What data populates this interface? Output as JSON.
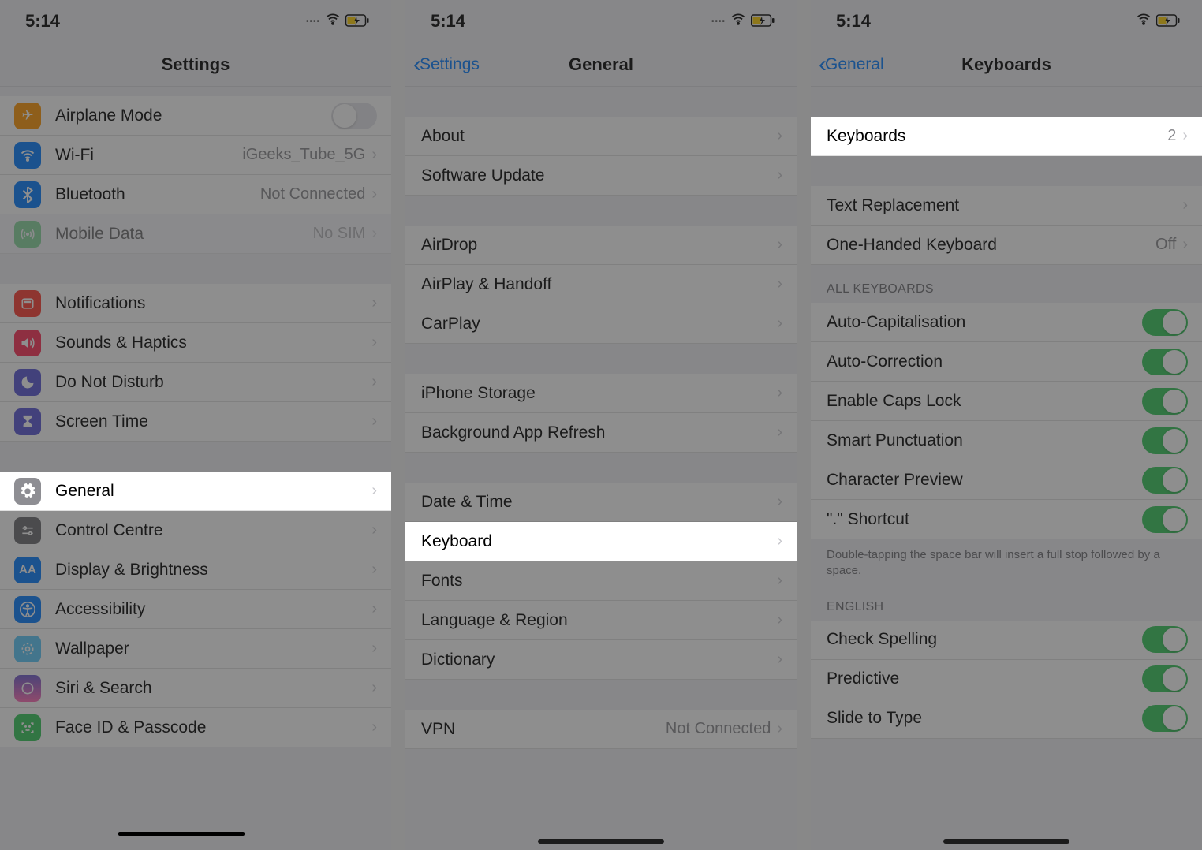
{
  "status": {
    "time": "5:14"
  },
  "phone1": {
    "title": "Settings",
    "rows": {
      "airplane": "Airplane Mode",
      "wifi": "Wi-Fi",
      "wifi_detail": "iGeeks_Tube_5G",
      "bluetooth": "Bluetooth",
      "bluetooth_detail": "Not Connected",
      "mobile": "Mobile Data",
      "mobile_detail": "No SIM",
      "notifications": "Notifications",
      "sounds": "Sounds & Haptics",
      "dnd": "Do Not Disturb",
      "screentime": "Screen Time",
      "general": "General",
      "control": "Control Centre",
      "display": "Display & Brightness",
      "accessibility": "Accessibility",
      "wallpaper": "Wallpaper",
      "siri": "Siri & Search",
      "faceid": "Face ID & Passcode"
    }
  },
  "phone2": {
    "back": "Settings",
    "title": "General",
    "rows": {
      "about": "About",
      "software": "Software Update",
      "airdrop": "AirDrop",
      "airplay": "AirPlay & Handoff",
      "carplay": "CarPlay",
      "storage": "iPhone Storage",
      "background": "Background App Refresh",
      "datetime": "Date & Time",
      "keyboard": "Keyboard",
      "fonts": "Fonts",
      "language": "Language & Region",
      "dictionary": "Dictionary",
      "vpn": "VPN",
      "vpn_detail": "Not Connected"
    }
  },
  "phone3": {
    "back": "General",
    "title": "Keyboards",
    "rows": {
      "keyboards": "Keyboards",
      "keyboards_count": "2",
      "text_replacement": "Text Replacement",
      "one_handed": "One-Handed Keyboard",
      "one_handed_detail": "Off",
      "header_all": "ALL KEYBOARDS",
      "auto_cap": "Auto-Capitalisation",
      "auto_correct": "Auto-Correction",
      "caps_lock": "Enable Caps Lock",
      "smart_punct": "Smart Punctuation",
      "char_preview": "Character Preview",
      "dot_shortcut": "\".\" Shortcut",
      "footer": "Double-tapping the space bar will insert a full stop followed by a space.",
      "header_english": "ENGLISH",
      "check_spelling": "Check Spelling",
      "predictive": "Predictive",
      "slide": "Slide to Type"
    }
  }
}
